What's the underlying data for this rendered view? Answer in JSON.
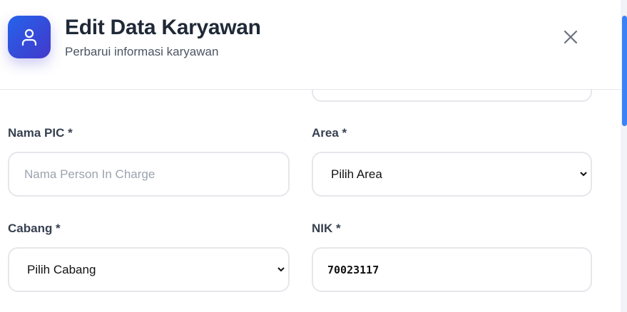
{
  "header": {
    "title": "Edit Data Karyawan",
    "subtitle": "Perbarui informasi karyawan",
    "icon": "user-icon",
    "close_icon": "close-icon"
  },
  "form": {
    "nama_pic": {
      "label": "Nama PIC *",
      "placeholder": "Nama Person In Charge",
      "value": ""
    },
    "area": {
      "label": "Area *",
      "selected": "Pilih Area"
    },
    "cabang": {
      "label": "Cabang *",
      "selected": "Pilih Cabang"
    },
    "nik": {
      "label": "NIK *",
      "value": "70023117"
    }
  },
  "colors": {
    "accent": "#2563eb",
    "accent_end": "#4338ca",
    "scroll_thumb": "#3b82f6"
  }
}
